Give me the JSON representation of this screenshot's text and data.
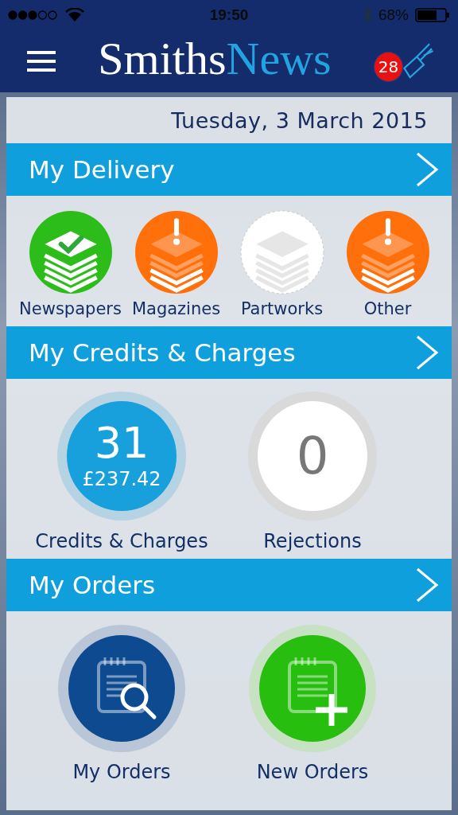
{
  "status_bar": {
    "time": "19:50",
    "battery": "68%"
  },
  "header": {
    "logo_first": "Smiths",
    "logo_second": "News",
    "badge": "28"
  },
  "date": "Tuesday, 3 March 2015",
  "delivery": {
    "title": "My Delivery",
    "items": [
      {
        "label": "Newspapers",
        "kind": "ok"
      },
      {
        "label": "Magazines",
        "kind": "alert"
      },
      {
        "label": "Partworks",
        "kind": "none"
      },
      {
        "label": "Other",
        "kind": "alert"
      }
    ]
  },
  "credits": {
    "title": "My Credits & Charges",
    "items": [
      {
        "kind": "credits",
        "count": "31",
        "amount": "£237.42",
        "label": "Credits & Charges"
      },
      {
        "kind": "rejections",
        "count": "0",
        "label": "Rejections"
      }
    ]
  },
  "orders": {
    "title": "My Orders",
    "items": [
      {
        "kind": "search",
        "label": "My Orders"
      },
      {
        "kind": "add",
        "label": "New Orders"
      }
    ]
  }
}
